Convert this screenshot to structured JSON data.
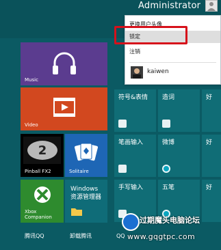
{
  "account": {
    "name": "Administrator"
  },
  "menu": {
    "items": [
      "更换用户头像",
      "锁定",
      "注销"
    ],
    "user": "kaiwen"
  },
  "tiles": {
    "music": "Music",
    "video": "Video",
    "pinball": "Pinball FX2",
    "solitaire": "Solitaire",
    "xbox_l1": "Xbox",
    "xbox_l2": "Companion",
    "explorer_l1": "Windows",
    "explorer_l2": "资源管理器"
  },
  "ime_tiles": [
    "符号&表情",
    "造词",
    "好",
    "笔画输入",
    "微博",
    "好",
    "手写输入",
    "五笔",
    "好"
  ],
  "bottom": {
    "left1": "腾讯QQ",
    "left2": "卸载腾讯",
    "mid": "QQ"
  },
  "watermark": {
    "title": "过期魔头电脑论坛",
    "url": "www.gqgtpc.com"
  }
}
